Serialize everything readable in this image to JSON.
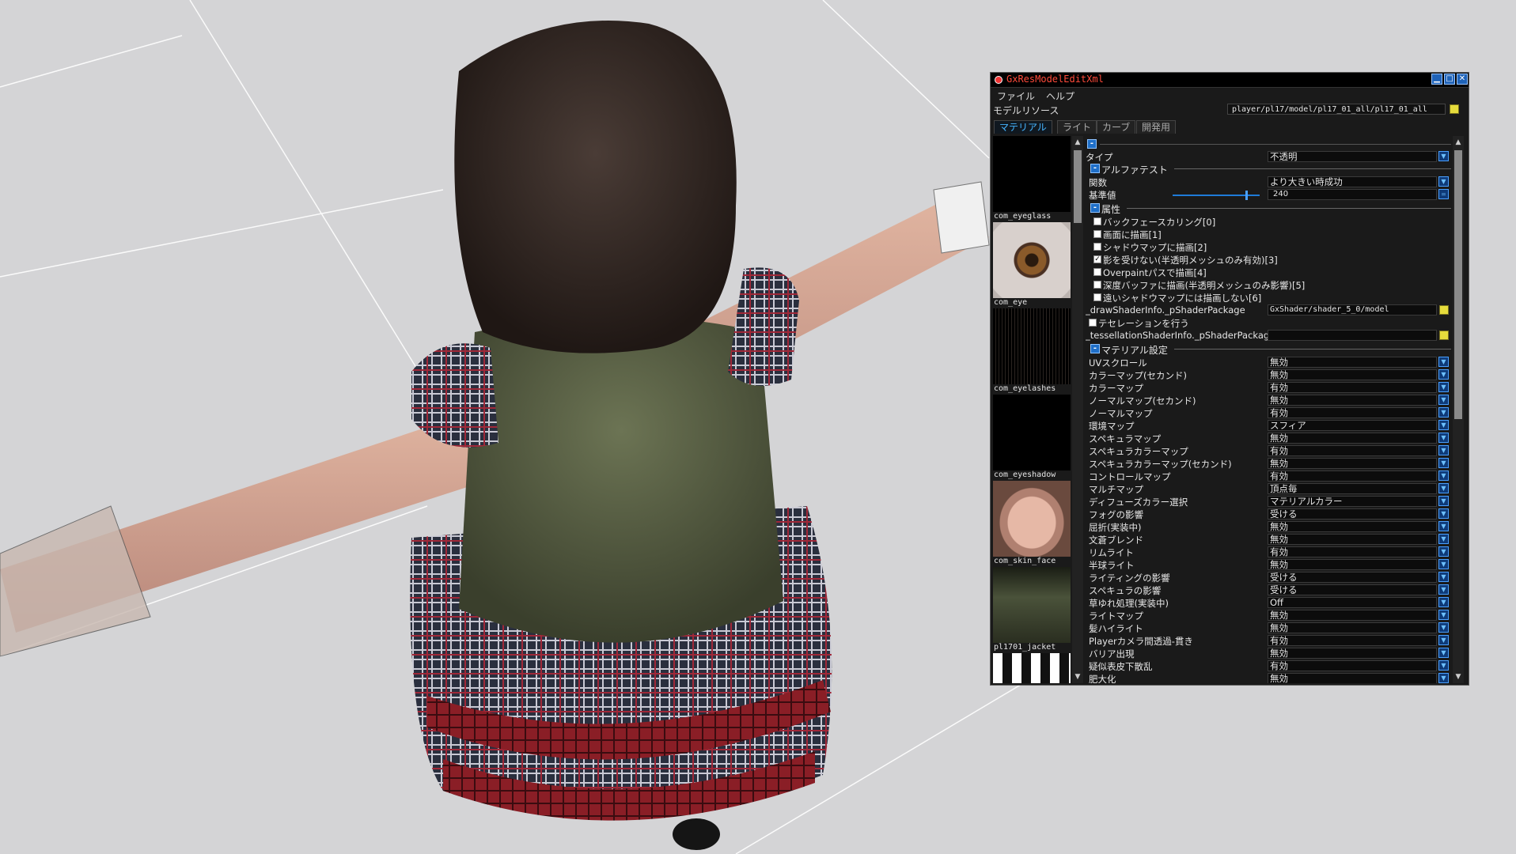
{
  "window": {
    "title": "GxResModelEditXml",
    "menu": [
      "ファイル",
      "ヘルプ"
    ],
    "resource_label": "モデルリソース",
    "resource_path": "player/pl17/model/pl17_01_all/pl17_01_all"
  },
  "tabs": [
    "マテリアル",
    "ライト",
    "カーブ",
    "開発用"
  ],
  "materials": [
    "com_eyeglass",
    "com_eye",
    "com_eyelashes",
    "com_eyeshadow",
    "com_skin_face",
    "pl1701_jacket"
  ],
  "props": {
    "type_label": "タイプ",
    "type_value": "不透明",
    "alpha_test_header": "アルファテスト",
    "func_label": "関数",
    "func_value": "より大きい時成功",
    "ref_label": "基準値",
    "ref_value": "240",
    "attr_header": "属性",
    "attributes": [
      {
        "label": "バックフェースカリング[0]",
        "checked": false
      },
      {
        "label": "画面に描画[1]",
        "checked": false
      },
      {
        "label": "シャドウマップに描画[2]",
        "checked": false
      },
      {
        "label": "影を受けない(半透明メッシュのみ有効)[3]",
        "checked": true
      },
      {
        "label": "Overpaintパスで描画[4]",
        "checked": false
      },
      {
        "label": "深度バッファに描画(半透明メッシュのみ影響)[5]",
        "checked": false
      },
      {
        "label": "遠いシャドウマップには描画しない[6]",
        "checked": false
      }
    ],
    "draw_shader_label": "_drawShaderInfo._pShaderPackage",
    "draw_shader_value": "GxShader/shader_5_0/model",
    "tessellation_label": "テセレーションを行う",
    "tess_shader_label": "_tessellationShaderInfo._pShaderPackage",
    "tess_shader_value": "",
    "material_settings_header": "マテリアル設定",
    "settings": [
      {
        "label": "UVスクロール",
        "value": "無効"
      },
      {
        "label": "カラーマップ(セカンド)",
        "value": "無効"
      },
      {
        "label": "カラーマップ",
        "value": "有効"
      },
      {
        "label": "ノーマルマップ(セカンド)",
        "value": "無効"
      },
      {
        "label": "ノーマルマップ",
        "value": "有効"
      },
      {
        "label": "環境マップ",
        "value": "スフィア"
      },
      {
        "label": "スペキュラマップ",
        "value": "無効"
      },
      {
        "label": "スペキュラカラーマップ",
        "value": "有効"
      },
      {
        "label": "スペキュラカラーマップ(セカンド)",
        "value": "無効"
      },
      {
        "label": "コントロールマップ",
        "value": "有効"
      },
      {
        "label": "マルチマップ",
        "value": "頂点毎"
      },
      {
        "label": "ディフューズカラー選択",
        "value": "マテリアルカラー"
      },
      {
        "label": "フォグの影響",
        "value": "受ける"
      },
      {
        "label": "屈折(実装中)",
        "value": "無効"
      },
      {
        "label": "文蒼ブレンド",
        "value": "無効"
      },
      {
        "label": "リムライト",
        "value": "有効"
      },
      {
        "label": "半球ライト",
        "value": "無効"
      },
      {
        "label": "ライティングの影響",
        "value": "受ける"
      },
      {
        "label": "スペキュラの影響",
        "value": "受ける"
      },
      {
        "label": "草ゆれ処理(実装中)",
        "value": "Off"
      },
      {
        "label": "ライトマップ",
        "value": "無効"
      },
      {
        "label": "髪ハイライト",
        "value": "無効"
      },
      {
        "label": "Playerカメラ間透過-貫き",
        "value": "有効"
      },
      {
        "label": "バリア出現",
        "value": "無効"
      },
      {
        "label": "疑似表皮下散乱",
        "value": "有効"
      },
      {
        "label": "肥大化",
        "value": "無効"
      }
    ]
  },
  "colors": {
    "accent": "#45b4ff",
    "title_text": "#ff4a3a",
    "panel_bg": "#1a1a1a",
    "viewport_bg": "#d4d4d6"
  }
}
